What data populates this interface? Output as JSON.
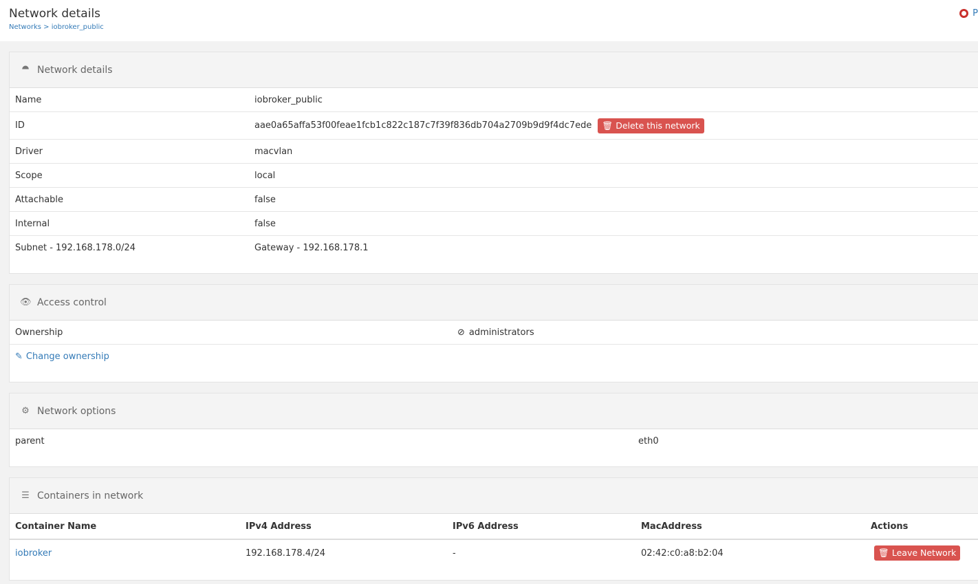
{
  "header": {
    "title": "Network details",
    "breadcrumb_root": "Networks",
    "breadcrumb_sep": ">",
    "breadcrumb_current": "iobroker_public",
    "help_label": "P"
  },
  "details": {
    "title": "Network details",
    "rows": [
      {
        "label": "Name",
        "value": "iobroker_public"
      },
      {
        "label": "ID",
        "value": "aae0a65affa53f00feae1fcb1c822c187c7f39f836db704a2709b9d9f4dc7ede"
      },
      {
        "label": "Driver",
        "value": "macvlan"
      },
      {
        "label": "Scope",
        "value": "local"
      },
      {
        "label": "Attachable",
        "value": "false"
      },
      {
        "label": "Internal",
        "value": "false"
      },
      {
        "label": "Subnet - 192.168.178.0/24",
        "value": "Gateway - 192.168.178.1"
      }
    ],
    "delete_label": "Delete this network"
  },
  "access": {
    "title": "Access control",
    "ownership_label": "Ownership",
    "ownership_value": "administrators",
    "change_label": "Change ownership"
  },
  "options": {
    "title": "Network options",
    "key": "parent",
    "value": "eth0"
  },
  "containers": {
    "title": "Containers in network",
    "headers": [
      "Container Name",
      "IPv4 Address",
      "IPv6 Address",
      "MacAddress",
      "Actions"
    ],
    "rows": [
      {
        "name": "iobroker",
        "ipv4": "192.168.178.4/24",
        "ipv6": "-",
        "mac": "02:42:c0:a8:b2:04",
        "action": "Leave Network"
      }
    ]
  }
}
